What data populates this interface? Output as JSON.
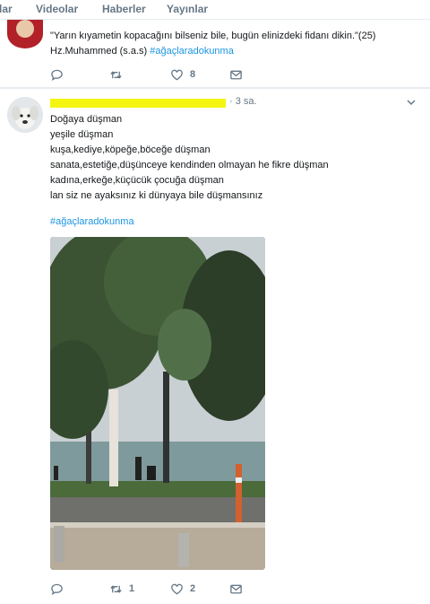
{
  "topnav": {
    "tabs": [
      {
        "label": "lar"
      },
      {
        "label": "Videolar"
      },
      {
        "label": "Haberler"
      },
      {
        "label": "Yayınlar"
      }
    ]
  },
  "tweet1": {
    "lines": [
      "\"Yarın kıyametin kopacağını bilseniz bile, bugün elinizdeki fidanı dikin.\"(25)",
      "Hz.Muhammed (s.a.s)"
    ],
    "hashtag": "#ağaçlaradokunma",
    "actions": {
      "reply_count": "",
      "retweet_count": "",
      "like_count": "8"
    }
  },
  "tweet2": {
    "time": "· 3 sa.",
    "lines": [
      "Doğaya düşman",
      "yeşile düşman",
      "kuşa,kediye,köpeğe,böceğe düşman",
      "sanata,estetiğe,düşünceye kendinden olmayan he fikre düşman",
      "kadına,erkeğe,küçücük çocuğa düşman",
      "lan siz ne ayaksınız ki dünyaya bile düşmansınız"
    ],
    "hashtag": "#ağaçlaradokunma",
    "actions": {
      "reply_count": "",
      "retweet_count": "1",
      "like_count": "2"
    }
  },
  "colors": {
    "accent": "#1b95e0",
    "secondary_text": "#657786",
    "highlight": "#f4f511"
  },
  "icons": [
    "reply-icon",
    "retweet-icon",
    "like-icon",
    "direct-message-icon",
    "caret-down-icon"
  ]
}
